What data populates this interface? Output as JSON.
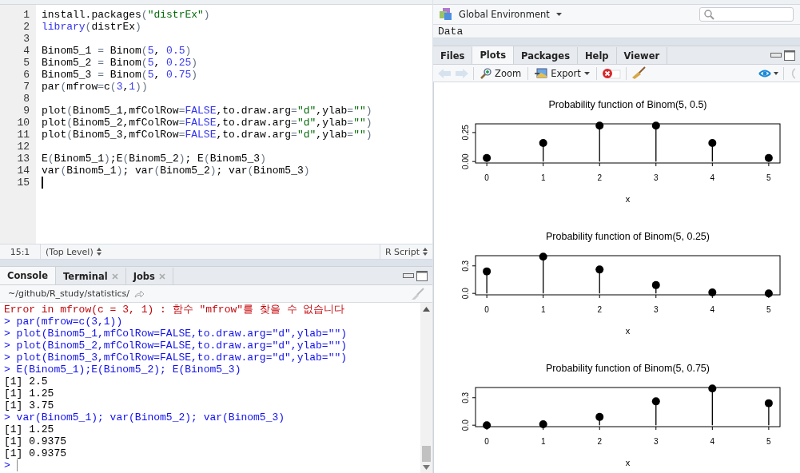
{
  "editor": {
    "lines": [
      {
        "number": "1",
        "cursor": false,
        "segments": [
          {
            "kind": "plain",
            "text": "install.packages"
          },
          {
            "kind": "op",
            "text": "("
          },
          {
            "kind": "str",
            "text": "\"distrEx\""
          },
          {
            "kind": "op",
            "text": ")"
          }
        ]
      },
      {
        "number": "2",
        "cursor": false,
        "segments": [
          {
            "kind": "kw",
            "text": "library"
          },
          {
            "kind": "op",
            "text": "("
          },
          {
            "kind": "plain",
            "text": "distrEx"
          },
          {
            "kind": "op",
            "text": ")"
          }
        ]
      },
      {
        "number": "3",
        "cursor": false
      },
      {
        "number": "4",
        "cursor": false,
        "segments": [
          {
            "kind": "plain",
            "text": "Binom5_1 "
          },
          {
            "kind": "op",
            "text": "="
          },
          {
            "kind": "plain",
            "text": " Binom"
          },
          {
            "kind": "op",
            "text": "("
          },
          {
            "kind": "num",
            "text": "5"
          },
          {
            "kind": "plain",
            "text": ", "
          },
          {
            "kind": "num",
            "text": "0.5"
          },
          {
            "kind": "op",
            "text": ")"
          }
        ]
      },
      {
        "number": "5",
        "cursor": false,
        "segments": [
          {
            "kind": "plain",
            "text": "Binom5_2 "
          },
          {
            "kind": "op",
            "text": "="
          },
          {
            "kind": "plain",
            "text": " Binom"
          },
          {
            "kind": "op",
            "text": "("
          },
          {
            "kind": "num",
            "text": "5"
          },
          {
            "kind": "plain",
            "text": ", "
          },
          {
            "kind": "num",
            "text": "0.25"
          },
          {
            "kind": "op",
            "text": ")"
          }
        ]
      },
      {
        "number": "6",
        "cursor": false,
        "segments": [
          {
            "kind": "plain",
            "text": "Binom5_3 "
          },
          {
            "kind": "op",
            "text": "="
          },
          {
            "kind": "plain",
            "text": " Binom"
          },
          {
            "kind": "op",
            "text": "("
          },
          {
            "kind": "num",
            "text": "5"
          },
          {
            "kind": "plain",
            "text": ", "
          },
          {
            "kind": "num",
            "text": "0.75"
          },
          {
            "kind": "op",
            "text": ")"
          }
        ]
      },
      {
        "number": "7",
        "cursor": false,
        "segments": [
          {
            "kind": "plain",
            "text": "par"
          },
          {
            "kind": "op",
            "text": "("
          },
          {
            "kind": "plain",
            "text": "mfrow"
          },
          {
            "kind": "op",
            "text": "="
          },
          {
            "kind": "plain",
            "text": "c"
          },
          {
            "kind": "op",
            "text": "("
          },
          {
            "kind": "num",
            "text": "3"
          },
          {
            "kind": "plain",
            "text": ","
          },
          {
            "kind": "num",
            "text": "1"
          },
          {
            "kind": "op",
            "text": "))"
          }
        ]
      },
      {
        "number": "8",
        "cursor": false
      },
      {
        "number": "9",
        "cursor": false,
        "segments": [
          {
            "kind": "plain",
            "text": "plot"
          },
          {
            "kind": "op",
            "text": "("
          },
          {
            "kind": "plain",
            "text": "Binom5_1,mfColRow"
          },
          {
            "kind": "op",
            "text": "="
          },
          {
            "kind": "kw",
            "text": "FALSE"
          },
          {
            "kind": "plain",
            "text": ",to.draw.arg"
          },
          {
            "kind": "op",
            "text": "="
          },
          {
            "kind": "str",
            "text": "\"d\""
          },
          {
            "kind": "plain",
            "text": ",ylab"
          },
          {
            "kind": "op",
            "text": "="
          },
          {
            "kind": "str",
            "text": "\"\""
          },
          {
            "kind": "op",
            "text": ")"
          }
        ]
      },
      {
        "number": "10",
        "cursor": false,
        "segments": [
          {
            "kind": "plain",
            "text": "plot"
          },
          {
            "kind": "op",
            "text": "("
          },
          {
            "kind": "plain",
            "text": "Binom5_2,mfColRow"
          },
          {
            "kind": "op",
            "text": "="
          },
          {
            "kind": "kw",
            "text": "FALSE"
          },
          {
            "kind": "plain",
            "text": ",to.draw.arg"
          },
          {
            "kind": "op",
            "text": "="
          },
          {
            "kind": "str",
            "text": "\"d\""
          },
          {
            "kind": "plain",
            "text": ",ylab"
          },
          {
            "kind": "op",
            "text": "="
          },
          {
            "kind": "str",
            "text": "\"\""
          },
          {
            "kind": "op",
            "text": ")"
          }
        ]
      },
      {
        "number": "11",
        "cursor": false,
        "segments": [
          {
            "kind": "plain",
            "text": "plot"
          },
          {
            "kind": "op",
            "text": "("
          },
          {
            "kind": "plain",
            "text": "Binom5_3,mfColRow"
          },
          {
            "kind": "op",
            "text": "="
          },
          {
            "kind": "kw",
            "text": "FALSE"
          },
          {
            "kind": "plain",
            "text": ",to.draw.arg"
          },
          {
            "kind": "op",
            "text": "="
          },
          {
            "kind": "str",
            "text": "\"d\""
          },
          {
            "kind": "plain",
            "text": ",ylab"
          },
          {
            "kind": "op",
            "text": "="
          },
          {
            "kind": "str",
            "text": "\"\""
          },
          {
            "kind": "op",
            "text": ")"
          }
        ]
      },
      {
        "number": "12",
        "cursor": false
      },
      {
        "number": "13",
        "cursor": false,
        "segments": [
          {
            "kind": "plain",
            "text": "E"
          },
          {
            "kind": "op",
            "text": "("
          },
          {
            "kind": "plain",
            "text": "Binom5_1"
          },
          {
            "kind": "op",
            "text": ")"
          },
          {
            "kind": "plain",
            "text": ";E"
          },
          {
            "kind": "op",
            "text": "("
          },
          {
            "kind": "plain",
            "text": "Binom5_2"
          },
          {
            "kind": "op",
            "text": ")"
          },
          {
            "kind": "plain",
            "text": "; E"
          },
          {
            "kind": "op",
            "text": "("
          },
          {
            "kind": "plain",
            "text": "Binom5_3"
          },
          {
            "kind": "op",
            "text": ")"
          }
        ]
      },
      {
        "number": "14",
        "cursor": false,
        "segments": [
          {
            "kind": "plain",
            "text": "var"
          },
          {
            "kind": "op",
            "text": "("
          },
          {
            "kind": "plain",
            "text": "Binom5_1"
          },
          {
            "kind": "op",
            "text": ")"
          },
          {
            "kind": "plain",
            "text": "; var"
          },
          {
            "kind": "op",
            "text": "("
          },
          {
            "kind": "plain",
            "text": "Binom5_2"
          },
          {
            "kind": "op",
            "text": ")"
          },
          {
            "kind": "plain",
            "text": "; var"
          },
          {
            "kind": "op",
            "text": "("
          },
          {
            "kind": "plain",
            "text": "Binom5_3"
          },
          {
            "kind": "op",
            "text": ")"
          }
        ]
      },
      {
        "number": "15",
        "cursor": true
      }
    ]
  },
  "editor_status": {
    "position": "15:1",
    "scope": "(Top Level)",
    "file_type": "R Script"
  },
  "console_pane": {
    "tabs": [
      {
        "label": "Console",
        "selected": true,
        "closable": false
      },
      {
        "label": "Terminal",
        "selected": false,
        "closable": true
      },
      {
        "label": "Jobs",
        "selected": false,
        "closable": true
      }
    ],
    "path": "~/github/R_study/statistics/",
    "lines": [
      {
        "kind": "error",
        "text": "Error in mfrow(c = 3, 1) : 함수 \"mfrow\"를 찾을 수 없습니다"
      },
      {
        "kind": "input",
        "text": "> par(mfrow=c(3,1))"
      },
      {
        "kind": "input",
        "text": "> plot(Binom5_1,mfColRow=FALSE,to.draw.arg=\"d\",ylab=\"\")"
      },
      {
        "kind": "input",
        "text": "> plot(Binom5_2,mfColRow=FALSE,to.draw.arg=\"d\",ylab=\"\")"
      },
      {
        "kind": "input",
        "text": "> plot(Binom5_3,mfColRow=FALSE,to.draw.arg=\"d\",ylab=\"\")"
      },
      {
        "kind": "input",
        "text": "> E(Binom5_1);E(Binom5_2); E(Binom5_3)"
      },
      {
        "kind": "output",
        "text": "[1] 2.5"
      },
      {
        "kind": "output",
        "text": "[1] 1.25"
      },
      {
        "kind": "output",
        "text": "[1] 3.75"
      },
      {
        "kind": "input",
        "text": "> var(Binom5_1); var(Binom5_2); var(Binom5_3)"
      },
      {
        "kind": "output",
        "text": "[1] 1.25"
      },
      {
        "kind": "output",
        "text": "[1] 0.9375"
      },
      {
        "kind": "output",
        "text": "[1] 0.9375"
      },
      {
        "kind": "prompt",
        "text": ">"
      }
    ]
  },
  "environment_pane": {
    "scope": "Global Environment",
    "section": "Data"
  },
  "plots_pane": {
    "tabs": [
      {
        "label": "Files",
        "selected": false
      },
      {
        "label": "Plots",
        "selected": true
      },
      {
        "label": "Packages",
        "selected": false
      },
      {
        "label": "Help",
        "selected": false
      },
      {
        "label": "Viewer",
        "selected": false
      }
    ],
    "toolbar": {
      "back": {
        "disabled": true
      },
      "forward": {
        "disabled": true
      },
      "zoom": "Zoom",
      "export": "Export"
    },
    "plots": [
      {
        "chart_data": {
          "type": "scatter",
          "title": "Probability function of Binom(5, 0.5)",
          "xlabel": "x",
          "x": [
            0,
            1,
            2,
            3,
            4,
            5
          ],
          "series": [
            {
              "color": "#000000",
              "values": [
                0.03,
                0.16,
                0.31,
                0.31,
                0.16,
                0.03
              ]
            }
          ],
          "xlim": [
            -0.2,
            5.2
          ],
          "ylim": [
            -0.0125,
            0.325
          ],
          "xticks": [
            0,
            1,
            2,
            3,
            4,
            5
          ],
          "yticks": [
            {
              "value": 0,
              "label": "0.00"
            },
            {
              "value": 0.25,
              "label": "0.25"
            }
          ]
        }
      },
      {
        "chart_data": {
          "type": "scatter",
          "title": "Probability function of Binom(5, 0.25)",
          "xlabel": "x",
          "x": [
            0,
            1,
            2,
            3,
            4,
            5
          ],
          "series": [
            {
              "color": "#000000",
              "values": [
                0.24,
                0.4,
                0.26,
                0.09,
                0.01,
                0
              ]
            }
          ],
          "xlim": [
            -0.2,
            5.2
          ],
          "ylim": [
            -0.0158,
            0.4113
          ],
          "xticks": [
            0,
            1,
            2,
            3,
            4,
            5
          ],
          "yticks": [
            {
              "value": 0,
              "label": "0.0"
            },
            {
              "value": 0.3,
              "label": "0.3"
            }
          ]
        }
      },
      {
        "chart_data": {
          "type": "scatter",
          "title": "Probability function of Binom(5, 0.75)",
          "xlabel": "x",
          "x": [
            0,
            1,
            2,
            3,
            4,
            5
          ],
          "series": [
            {
              "color": "#000000",
              "values": [
                0,
                0.01,
                0.09,
                0.26,
                0.4,
                0.24
              ]
            }
          ],
          "xlim": [
            -0.2,
            5.2
          ],
          "ylim": [
            -0.0158,
            0.4113
          ],
          "xticks": [
            0,
            1,
            2,
            3,
            4,
            5
          ],
          "yticks": [
            {
              "value": 0,
              "label": "0.0"
            },
            {
              "value": 0.3,
              "label": "0.3"
            }
          ]
        }
      }
    ]
  }
}
